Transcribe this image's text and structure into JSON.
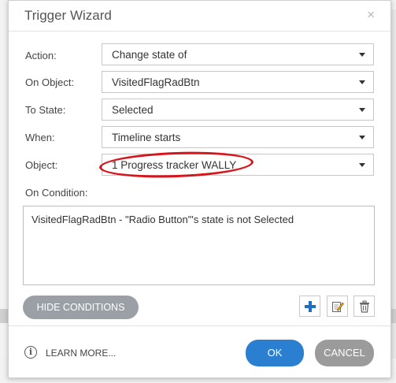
{
  "dialog": {
    "title": "Trigger Wizard",
    "close_glyph": "×"
  },
  "fields": {
    "action": {
      "label": "Action:",
      "value": "Change state of"
    },
    "on_object": {
      "label": "On Object:",
      "value": "VisitedFlagRadBtn"
    },
    "to_state": {
      "label": "To State:",
      "value": "Selected"
    },
    "when": {
      "label": "When:",
      "value": "Timeline starts"
    },
    "object": {
      "label": "Object:",
      "value": "1 Progress tracker WALLY"
    }
  },
  "condition": {
    "label": "On Condition:",
    "text": "VisitedFlagRadBtn - \"Radio Button\"'s state is not Selected"
  },
  "buttons": {
    "hide_conditions": "HIDE CONDITIONS",
    "learn_more": "LEARN MORE...",
    "ok": "OK",
    "cancel": "CANCEL"
  },
  "icons": {
    "add": "plus-icon",
    "edit": "edit-icon",
    "delete": "trash-icon",
    "info": "info-icon",
    "info_glyph": "i"
  },
  "colors": {
    "ok_button": "#2a7fd1",
    "highlight": "#d8141b",
    "plus_icon": "#1f6fc0"
  }
}
